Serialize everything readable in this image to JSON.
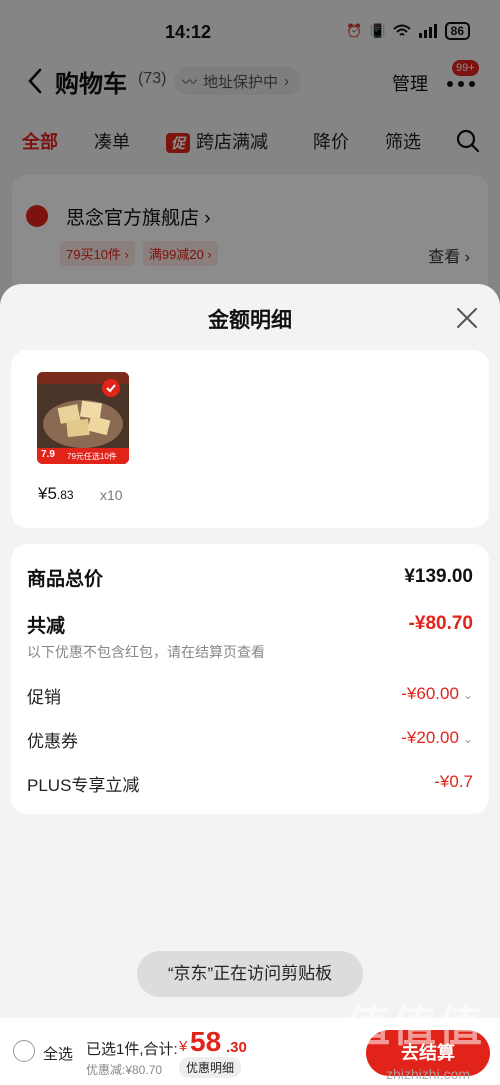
{
  "status": {
    "time": "14:12",
    "battery": "86"
  },
  "nav": {
    "title": "购物车",
    "count": "(73)",
    "address": "地址保护中",
    "manage": "管理",
    "more_badge": "99+"
  },
  "tabs": [
    "全部",
    "凑单",
    "跨店满减",
    "降价",
    "筛选"
  ],
  "promo_tag": "促",
  "store": {
    "name": "思念官方旗舰店",
    "tags": [
      "79买10件",
      "满99减20"
    ],
    "view": "查看"
  },
  "sheet": {
    "title": "金额明细",
    "product": {
      "img_banner": "79元任选10件",
      "img_price": "7.9",
      "price_yen": "¥5",
      "price_cents": ".83",
      "qty": "x10"
    },
    "rows": {
      "total_label": "商品总价",
      "total_value": "¥139.00",
      "reduce_label": "共减",
      "reduce_value": "-¥80.70",
      "reduce_note": "以下优惠不包含红包，请在结算页查看",
      "promo_label": "促销",
      "promo_value": "-¥60.00",
      "coupon_label": "优惠券",
      "coupon_value": "-¥20.00",
      "plus_label": "PLUS专享立减",
      "plus_value": "-¥0.7"
    },
    "toast": "“京东”正在访问剪贴板",
    "footer": {
      "select_all": "全选",
      "summary": "已选1件,合计:",
      "yen": "¥",
      "amount_int": "58",
      "amount_dec": ".30",
      "discount": "优惠减:¥80.70",
      "detail_btn": "优惠明细",
      "checkout": "去结算"
    },
    "watermark": "值值值",
    "watermark_url": "zhizhizhi.com"
  },
  "colors": {
    "accent": "#e2231a"
  }
}
